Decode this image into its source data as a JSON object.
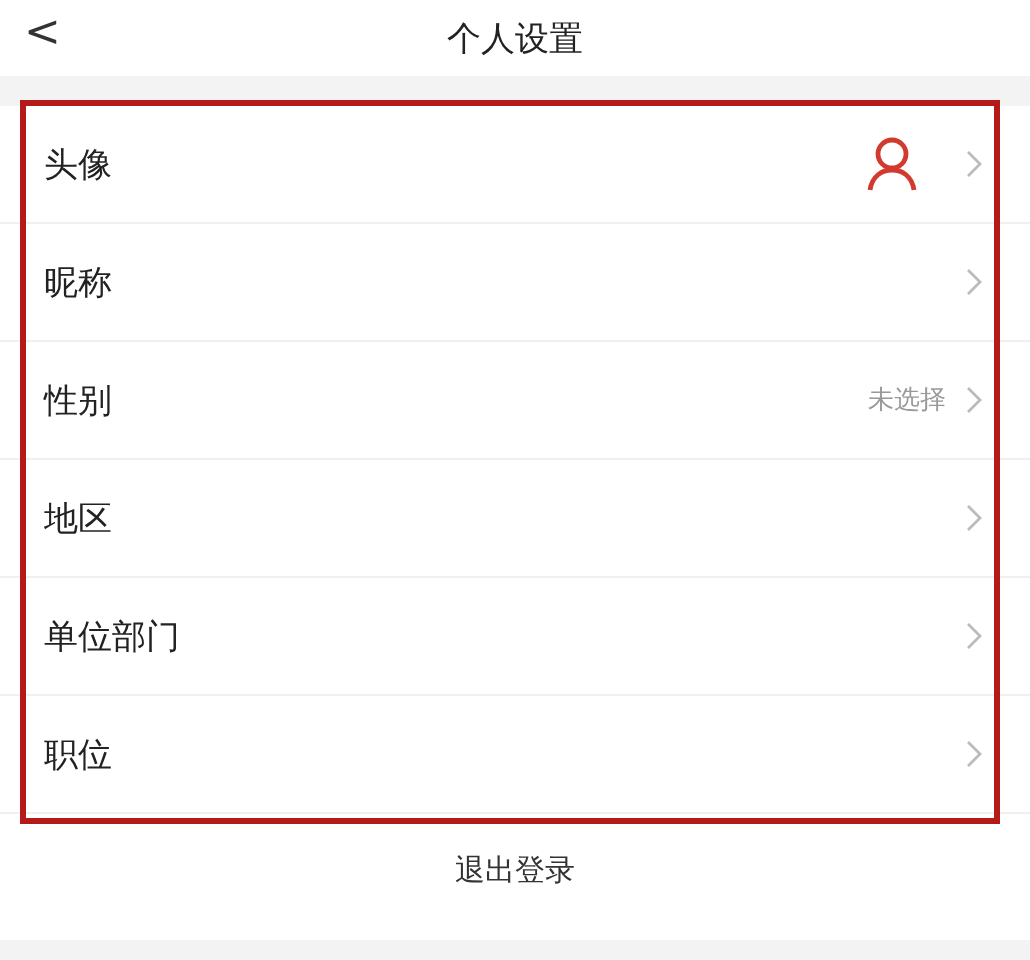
{
  "header": {
    "back": "<",
    "title": "个人设置"
  },
  "rows": [
    {
      "kind": "avatar",
      "label": "头像"
    },
    {
      "kind": "plain",
      "label": "昵称"
    },
    {
      "kind": "value",
      "label": "性别",
      "value": "未选择"
    },
    {
      "kind": "plain",
      "label": "地区"
    },
    {
      "kind": "plain",
      "label": "单位部门"
    },
    {
      "kind": "plain",
      "label": "职位"
    }
  ],
  "logout": "退出登录"
}
